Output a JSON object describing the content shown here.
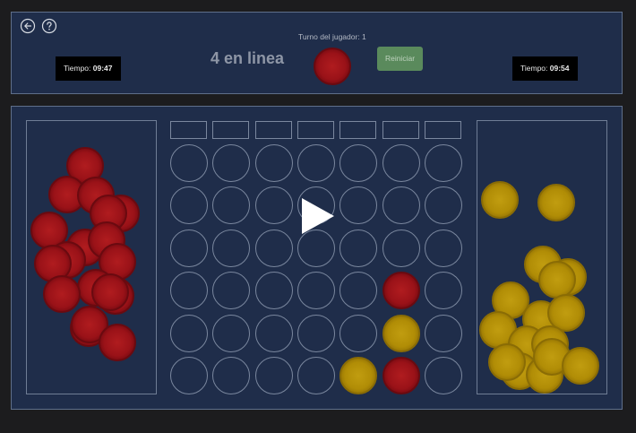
{
  "header": {
    "title": "4 en linea",
    "turn_label": "Turno del jugador: 1",
    "restart_label": "Reiniciar",
    "player1_timer": {
      "label": "Tiempo:",
      "value": "09:47"
    },
    "player2_timer": {
      "label": "Tiempo:",
      "value": "09:54"
    },
    "back_icon": "arrow-left-circle",
    "help_icon": "question-circle"
  },
  "colors": {
    "panel_bg": "#1f2d4a",
    "red_piece": "#9a1218",
    "yellow_piece": "#b18d06",
    "restart_button": "#5a8a5c"
  },
  "board": {
    "columns": 7,
    "rows": 6,
    "cells": [
      [
        "",
        "",
        "",
        "",
        "",
        "",
        ""
      ],
      [
        "",
        "",
        "",
        "",
        "",
        "",
        ""
      ],
      [
        "",
        "",
        "",
        "",
        "",
        "",
        ""
      ],
      [
        "",
        "",
        "",
        "",
        "",
        "red",
        ""
      ],
      [
        "",
        "",
        "",
        "",
        "",
        "yellow",
        ""
      ],
      [
        "",
        "",
        "",
        "",
        "yellow",
        "red",
        ""
      ]
    ]
  },
  "current_turn_piece": "red",
  "overlay_icon": "play-icon"
}
